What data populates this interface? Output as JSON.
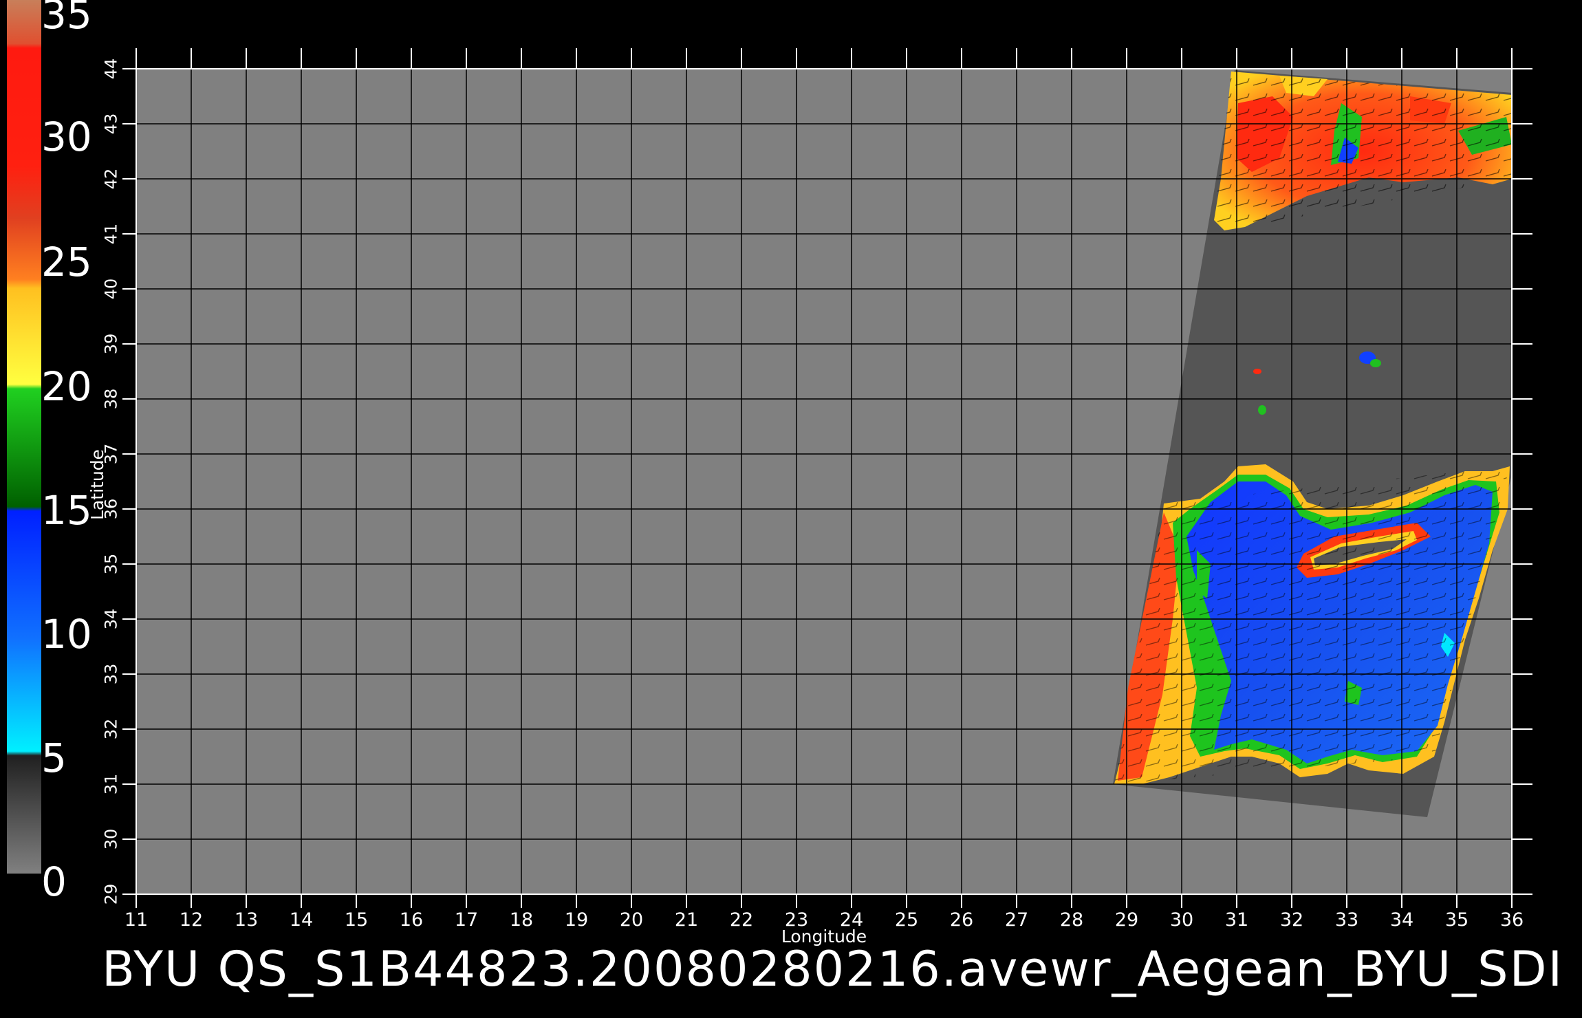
{
  "title": "BYU  QS_S1B44823.20080280216.avewr_Aegean_BYU_SDI",
  "axes": {
    "xlabel": "Longitude",
    "ylabel": "Latitude",
    "lon_ticks": [
      "11",
      "12",
      "13",
      "14",
      "15",
      "16",
      "17",
      "18",
      "19",
      "20",
      "21",
      "22",
      "23",
      "24",
      "25",
      "26",
      "27",
      "28",
      "29",
      "30",
      "31",
      "32",
      "33",
      "34",
      "35",
      "36"
    ],
    "lat_ticks": [
      "29",
      "30",
      "31",
      "32",
      "33",
      "34",
      "35",
      "36",
      "37",
      "38",
      "39",
      "40",
      "41",
      "42",
      "43",
      "44"
    ]
  },
  "colorbar": {
    "labels": [
      "35",
      "30",
      "25",
      "20",
      "15",
      "10",
      "5",
      "0"
    ],
    "colors": {
      "c35": "#c87f5a",
      "c30": "#ff1a10",
      "c25": "#ff6a1a",
      "c20": "#ffee20",
      "c15": "#00b000",
      "c10": "#1040ff",
      "c5": "#00f0ff",
      "c0": "#555555"
    }
  },
  "map": {
    "land_color": "#808080",
    "swath_color": "#555555",
    "grid_color": "#000000"
  }
}
